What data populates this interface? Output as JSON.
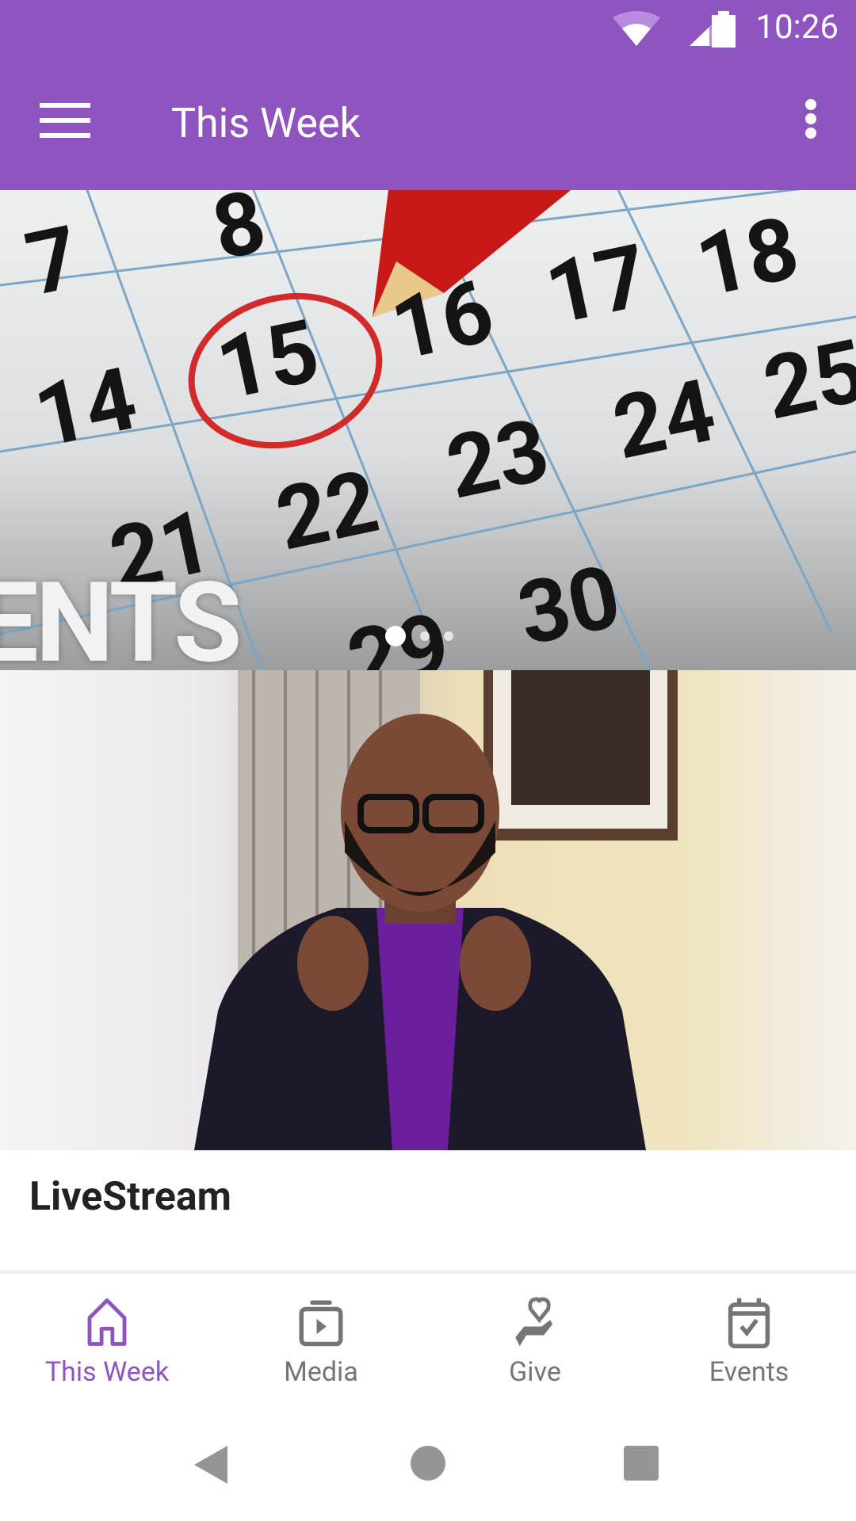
{
  "status_bar": {
    "time": "10:26",
    "icons": [
      "wifi-icon",
      "signal-icon",
      "battery-icon"
    ]
  },
  "app_bar": {
    "title": "This Week",
    "menu_icon": "hamburger-icon",
    "more_icon": "more-vert-icon"
  },
  "banner": {
    "calendar_numbers": [
      "7",
      "8",
      "14",
      "15",
      "16",
      "17",
      "18",
      "21",
      "22",
      "23",
      "24",
      "25",
      "29",
      "30"
    ],
    "overlay_text": "ENTS",
    "carousel_pages": 3,
    "carousel_active": 1
  },
  "card": {
    "title": "LiveStream"
  },
  "bottom_nav": {
    "items": [
      {
        "label": "This Week",
        "icon": "home-icon",
        "active": true
      },
      {
        "label": "Media",
        "icon": "media-play-icon",
        "active": false
      },
      {
        "label": "Give",
        "icon": "give-heart-hand-icon",
        "active": false
      },
      {
        "label": "Events",
        "icon": "calendar-check-icon",
        "active": false
      }
    ]
  },
  "colors": {
    "primary": "#8e54c0",
    "inactive": "#757575",
    "sysnav": "#959595"
  }
}
